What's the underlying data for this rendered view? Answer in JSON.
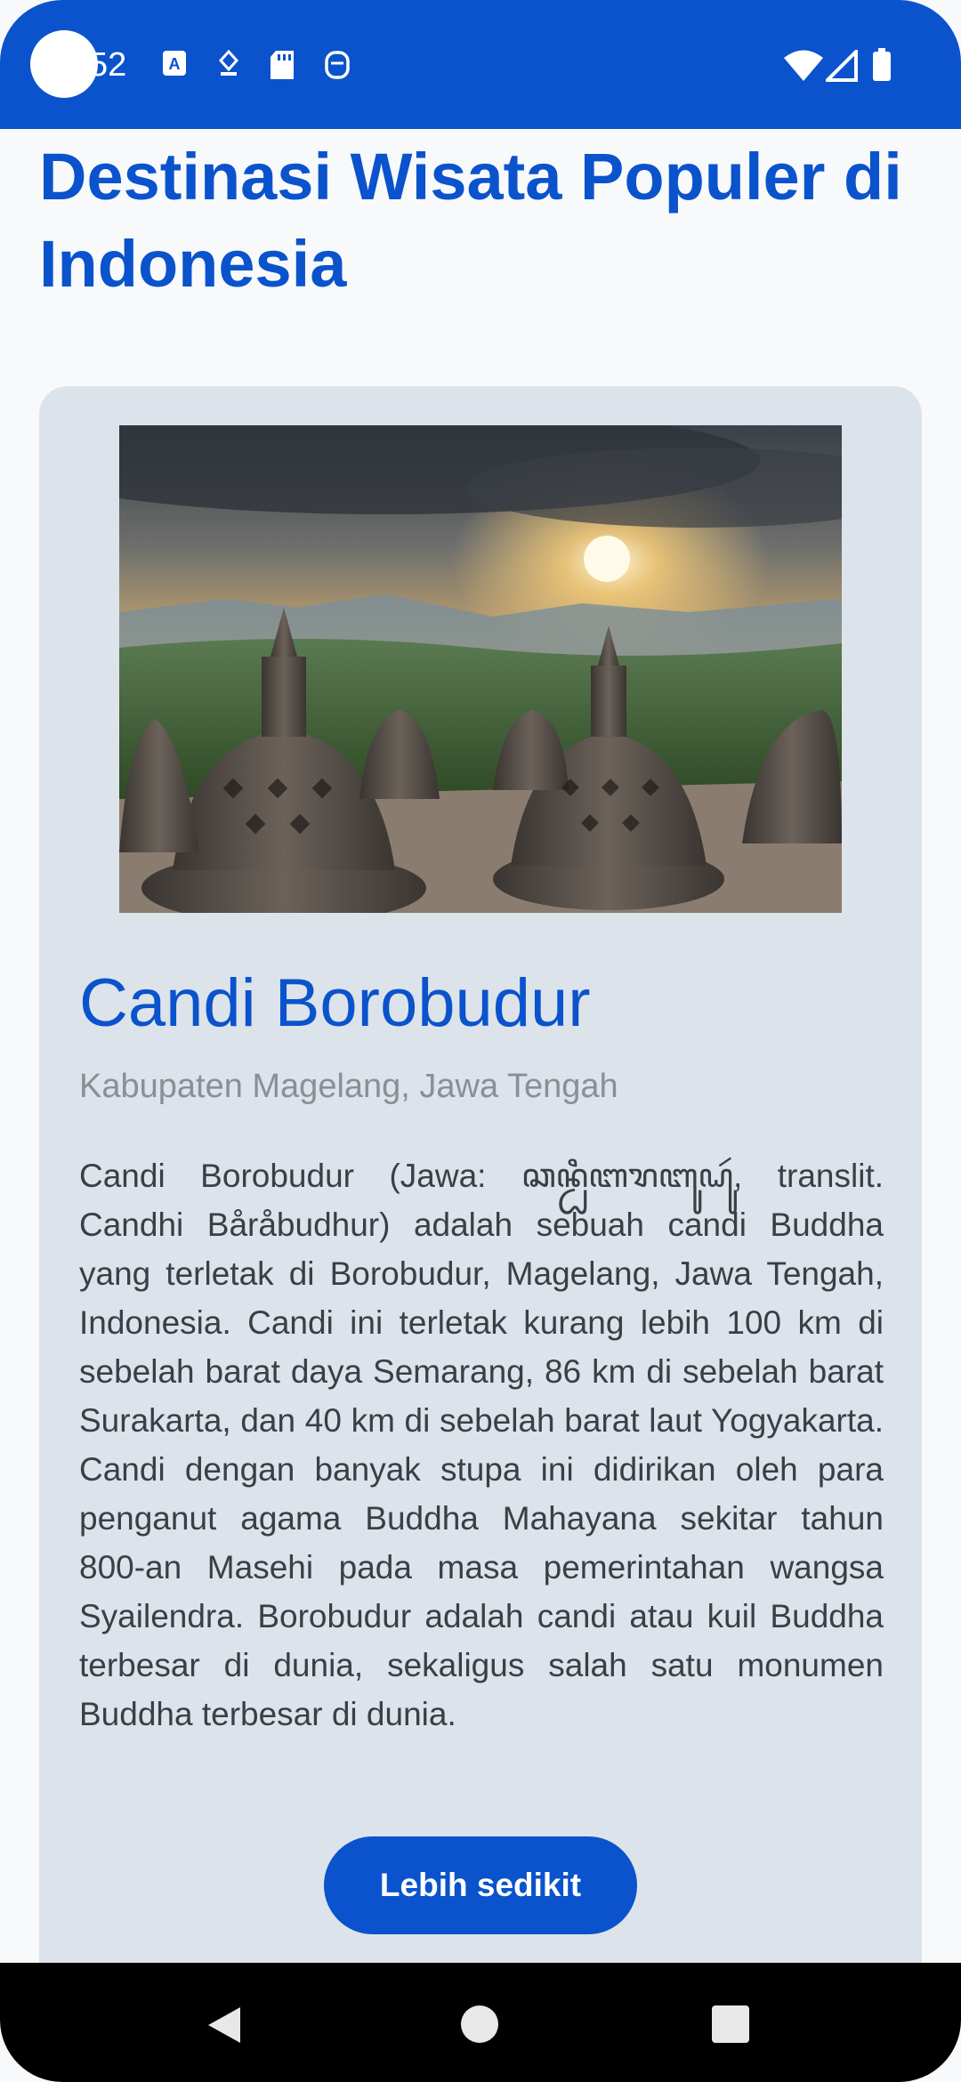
{
  "status_bar": {
    "time": "52",
    "icons": [
      "notification-a-icon",
      "location-pin-icon",
      "sd-card-icon",
      "face-icon"
    ],
    "right_icons": [
      "wifi-icon",
      "signal-icon",
      "battery-icon"
    ]
  },
  "page": {
    "title": "Destinasi Wisata Populer di Indonesia"
  },
  "card": {
    "image_name": "borobudur-sunset-image",
    "name": "Candi Borobudur",
    "location": "Kabupaten Magelang, Jawa Tengah",
    "description": "Candi Borobudur (Jawa: ꦕꦤ꧀ꦝꦶꦧꦫꦧꦸꦝꦸꦂ, translit. Candhi Båråbudhur) adalah sebuah candi Buddha yang terletak di Borobudur, Magelang, Jawa Tengah, Indonesia. Candi ini terletak kurang lebih 100 km di sebelah barat daya Semarang, 86 km di sebelah barat Surakarta, dan 40 km di sebelah barat laut Yogyakarta. Candi dengan banyak stupa ini didirikan oleh para penganut agama Buddha Mahayana sekitar tahun 800-an Masehi pada masa pemerintahan wangsa Syailendra. Borobudur adalah candi atau kuil Buddha terbesar di dunia, sekaligus salah satu monumen Buddha terbesar di dunia.",
    "button_label": "Lebih sedikit"
  },
  "colors": {
    "accent": "#0a53cc",
    "card_bg": "#dde3ea",
    "page_bg": "#f8f9fb"
  },
  "nav_bar": {
    "icons": [
      "back-icon",
      "home-icon",
      "recent-apps-icon"
    ]
  }
}
